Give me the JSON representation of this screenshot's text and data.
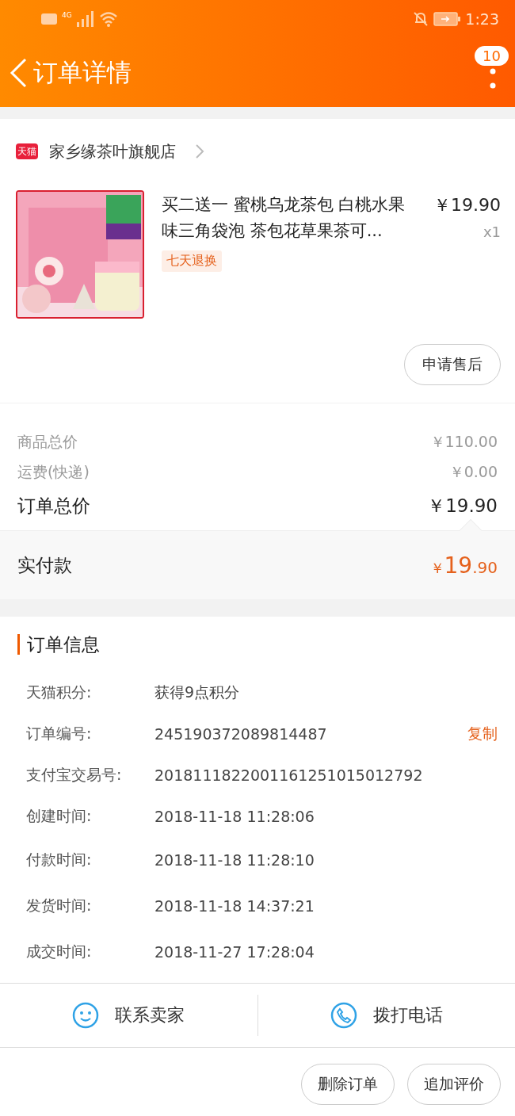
{
  "status_bar": {
    "time": "1:23",
    "network": "4G"
  },
  "header": {
    "title": "订单详情",
    "badge": "10"
  },
  "shop": {
    "logo": "天猫",
    "name": "家乡缘茶叶旗舰店"
  },
  "product": {
    "title": "买二送一 蜜桃乌龙茶包 白桃水果味三角袋泡 茶包花草果茶可...",
    "price": "￥19.90",
    "quantity": "x1",
    "tag": "七天退换",
    "action": "申请售后"
  },
  "price_summary": [
    {
      "kind": "minor",
      "label": "商品总价",
      "value": "￥110.00"
    },
    {
      "kind": "minor",
      "label": "运费(快递)",
      "value": "￥0.00"
    },
    {
      "kind": "major",
      "label": "订单总价",
      "value": "￥19.90"
    }
  ],
  "paid": {
    "label": "实付款",
    "symbol": "￥",
    "integer": "19",
    "decimal": ".90"
  },
  "order_info": {
    "title": "订单信息",
    "rows": [
      {
        "label": "天猫积分:",
        "value": "获得9点积分"
      },
      {
        "label": "订单编号:",
        "value": "245190372089814487",
        "action": "复制"
      },
      {
        "label": "支付宝交易号:",
        "value": "2018111822001161251015012792"
      },
      {
        "label": "创建时间:",
        "value": "2018-11-18 11:28:06"
      },
      {
        "label": "付款时间:",
        "value": "2018-11-18 11:28:10"
      },
      {
        "label": "发货时间:",
        "value": "2018-11-18 14:37:21"
      },
      {
        "label": "成交时间:",
        "value": "2018-11-27 17:28:04"
      }
    ]
  },
  "contact_bar": [
    {
      "kind": "chat",
      "label": "联系卖家"
    },
    {
      "kind": "phone",
      "label": "拨打电话"
    }
  ],
  "bottom_buttons": [
    "删除订单",
    "追加评价"
  ]
}
